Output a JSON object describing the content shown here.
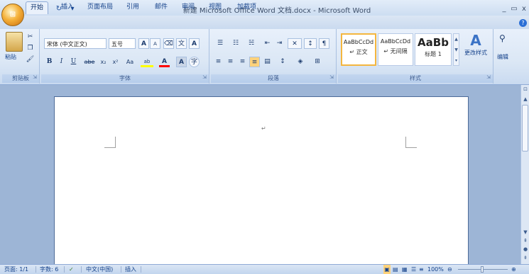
{
  "window": {
    "title": "新建 Microsoft Office Word 文档.docx - Microsoft Word",
    "controls": {
      "minimize": "_",
      "restore": "▭",
      "close": "x"
    }
  },
  "quick_access": {
    "save": "💾",
    "undo": "↶",
    "repeat": "↻",
    "dropdown": "▾"
  },
  "tabs": [
    "开始",
    "插入",
    "页面布局",
    "引用",
    "邮件",
    "审阅",
    "视图",
    "加载项"
  ],
  "help_icon": "?",
  "ribbon": {
    "clipboard": {
      "label": "剪贴板",
      "paste": "粘贴"
    },
    "font": {
      "label": "字体",
      "font_name": "宋体 (中文正文)",
      "font_size": "五号",
      "grow": "A",
      "shrink": "A",
      "bold": "B",
      "italic": "I",
      "underline": "U",
      "strike": "abe",
      "subscript": "x₂",
      "superscript": "x²",
      "change_case": "Aa",
      "highlight": "ab",
      "font_color": "A",
      "char_shading": "A",
      "enclose": "字"
    },
    "paragraph": {
      "label": "段落"
    },
    "styles": {
      "label": "样式",
      "tiles": [
        {
          "sample": "AaBbCcDd",
          "name": "↵ 正文"
        },
        {
          "sample": "AaBbCcDd",
          "name": "↵ 无间隔"
        },
        {
          "sample": "AaBb",
          "name": "标题 1"
        }
      ],
      "change_styles": "更改样式"
    },
    "editing": {
      "label": "编辑"
    }
  },
  "document": {
    "paragraph_mark": "↵"
  },
  "status": {
    "page": "页面: 1/1",
    "words": "字数: 6",
    "language": "中文(中国)",
    "insert_mode": "插入",
    "zoom": "100%"
  },
  "colors": {
    "highlight": "#ffff00",
    "font_color": "#ff0000",
    "accent": "#15428b"
  }
}
